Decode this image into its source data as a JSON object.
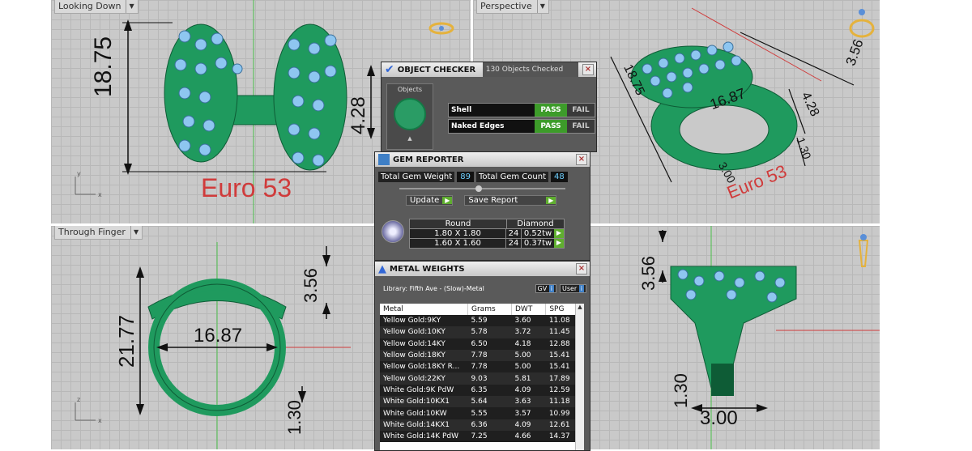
{
  "viewports": {
    "top_left": {
      "label": "Looking Down",
      "dims": {
        "height": "18.75",
        "side": "4.28"
      },
      "euro": "Euro 53"
    },
    "top_right": {
      "label": "Perspective",
      "dims": {
        "a": "3.56",
        "b": "16.87",
        "c": "4.28",
        "d": "1.30",
        "e": "3.00",
        "f": "18.75"
      },
      "euro": "Euro 53"
    },
    "bottom_left": {
      "label": "Through Finger",
      "dims": {
        "height": "21.77",
        "width": "16.87",
        "top": "3.56",
        "bottom": "1.30"
      }
    },
    "bottom_right": {
      "dims": {
        "top": "3.56",
        "bottom": "1.30",
        "width": "3.00"
      }
    }
  },
  "object_checker": {
    "title": "OBJECT CHECKER",
    "status": "130 Objects Checked",
    "objects_label": "Objects",
    "rows": [
      {
        "label": "Shell",
        "pass": "PASS",
        "fail": "FAIL"
      },
      {
        "label": "Naked Edges",
        "pass": "PASS",
        "fail": "FAIL"
      }
    ]
  },
  "gem_reporter": {
    "title": "GEM REPORTER",
    "weight_label": "Total Gem Weight",
    "weight_value": "89",
    "count_label": "Total Gem Count",
    "count_value": "48",
    "update_label": "Update",
    "save_label": "Save Report",
    "col_shape": "Round",
    "col_type": "Diamond",
    "rows": [
      {
        "size": "1.80 X 1.80",
        "count": "24",
        "tw": "0.52tw"
      },
      {
        "size": "1.60 X 1.60",
        "count": "24",
        "tw": "0.37tw"
      }
    ]
  },
  "metal_weights": {
    "title": "METAL WEIGHTS",
    "library": "Library: Fifth Ave - (Slow)-Metal",
    "gv_label": "GV",
    "user_label": "User",
    "headers": [
      "Metal",
      "Grams",
      "DWT",
      "SPG"
    ],
    "rows": [
      [
        "Yellow Gold:9KY",
        "5.59",
        "3.60",
        "11.08"
      ],
      [
        "Yellow Gold:10KY",
        "5.78",
        "3.72",
        "11.45"
      ],
      [
        "Yellow Gold:14KY",
        "6.50",
        "4.18",
        "12.88"
      ],
      [
        "Yellow Gold:18KY",
        "7.78",
        "5.00",
        "15.41"
      ],
      [
        "Yellow Gold:18KY R...",
        "7.78",
        "5.00",
        "15.41"
      ],
      [
        "Yellow Gold:22KY",
        "9.03",
        "5.81",
        "17.89"
      ],
      [
        "White Gold:9K PdW",
        "6.35",
        "4.09",
        "12.59"
      ],
      [
        "White Gold:10KX1",
        "5.64",
        "3.63",
        "11.18"
      ],
      [
        "White Gold:10KW",
        "5.55",
        "3.57",
        "10.99"
      ],
      [
        "White Gold:14KX1",
        "6.36",
        "4.09",
        "12.61"
      ],
      [
        "White Gold:14K PdW",
        "7.25",
        "4.66",
        "14.37"
      ]
    ]
  }
}
